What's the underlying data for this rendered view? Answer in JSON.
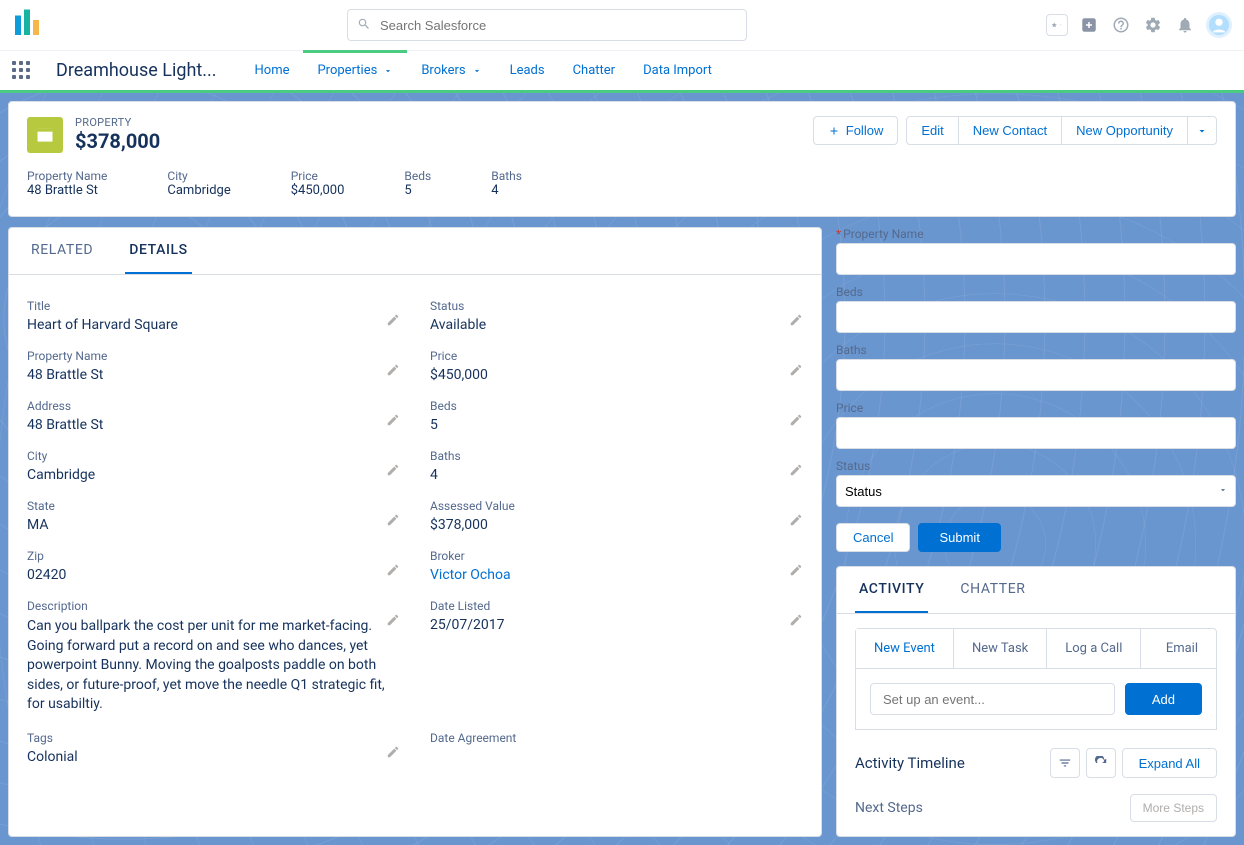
{
  "search": {
    "placeholder": "Search Salesforce"
  },
  "app_name": "Dreamhouse Light...",
  "nav": {
    "home": "Home",
    "properties": "Properties",
    "brokers": "Brokers",
    "leads": "Leads",
    "chatter": "Chatter",
    "data_import": "Data Import"
  },
  "record": {
    "object_label": "PROPERTY",
    "title": "$378,000",
    "actions": {
      "follow": "Follow",
      "edit": "Edit",
      "new_contact": "New Contact",
      "new_opportunity": "New Opportunity"
    },
    "compact": {
      "property_name_label": "Property Name",
      "property_name": "48 Brattle St",
      "city_label": "City",
      "city": "Cambridge",
      "price_label": "Price",
      "price": "$450,000",
      "beds_label": "Beds",
      "beds": "5",
      "baths_label": "Baths",
      "baths": "4"
    }
  },
  "tabs": {
    "related": "RELATED",
    "details": "DETAILS"
  },
  "details": {
    "title_l": "Title",
    "title_v": "Heart of Harvard Square",
    "status_l": "Status",
    "status_v": "Available",
    "pname_l": "Property Name",
    "pname_v": "48 Brattle St",
    "price_l": "Price",
    "price_v": "$450,000",
    "address_l": "Address",
    "address_v": "48 Brattle St",
    "beds_l": "Beds",
    "beds_v": "5",
    "city_l": "City",
    "city_v": "Cambridge",
    "baths_l": "Baths",
    "baths_v": "4",
    "state_l": "State",
    "state_v": "MA",
    "assessed_l": "Assessed Value",
    "assessed_v": "$378,000",
    "zip_l": "Zip",
    "zip_v": "02420",
    "broker_l": "Broker",
    "broker_v": "Victor Ochoa",
    "desc_l": "Description",
    "desc_v": "Can you ballpark the cost per unit for me market-facing. Going forward put a record on and see who dances, yet powerpoint Bunny. Moving the goalposts paddle on both sides, or future-proof, yet move the needle Q1 strategic fit, for usabiltiy.",
    "date_listed_l": "Date Listed",
    "date_listed_v": "25/07/2017",
    "tags_l": "Tags",
    "tags_v": "Colonial",
    "date_agree_l": "Date Agreement"
  },
  "form": {
    "property_name": "Property Name",
    "beds": "Beds",
    "baths": "Baths",
    "price": "Price",
    "status": "Status",
    "status_selected": "Status",
    "cancel": "Cancel",
    "submit": "Submit"
  },
  "activity": {
    "tab_activity": "ACTIVITY",
    "tab_chatter": "CHATTER",
    "sub_new_event": "New Event",
    "sub_new_task": "New Task",
    "sub_log_call": "Log a Call",
    "sub_email": "Email",
    "event_placeholder": "Set up an event...",
    "add": "Add",
    "timeline": "Activity Timeline",
    "expand_all": "Expand All",
    "next_steps": "Next Steps",
    "more_steps": "More Steps"
  }
}
